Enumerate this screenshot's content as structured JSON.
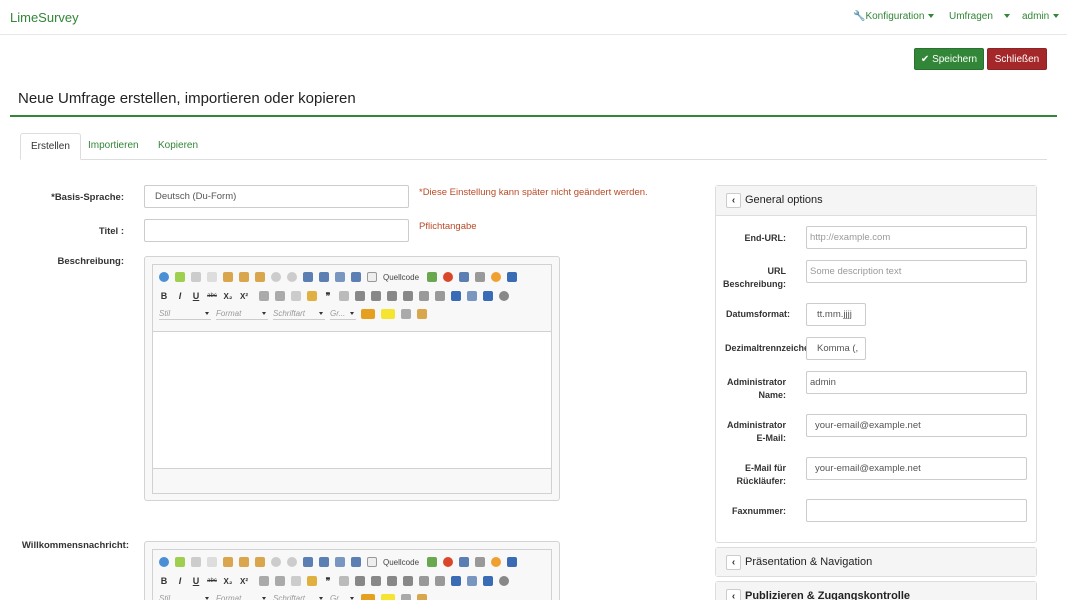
{
  "app": {
    "brand": "LimeSurvey"
  },
  "nav": {
    "config": "Konfiguration",
    "surveys": "Umfragen",
    "user": "admin"
  },
  "actions": {
    "save": "Speichern",
    "close": "Schließen"
  },
  "page": {
    "title": "Neue Umfrage erstellen, importieren oder kopieren"
  },
  "tabs": [
    "Erstellen",
    "Importieren",
    "Kopieren"
  ],
  "form": {
    "base_lang_label": "*Basis-Sprache:",
    "base_lang_value": "Deutsch (Du-Form)",
    "base_lang_hint": "*Diese Einstellung kann später nicht geändert werden.",
    "title_label": "Titel :",
    "title_hint": "Pflichtangabe",
    "desc_label": "Beschreibung:",
    "welcome_label": "Willkommensnachricht:"
  },
  "editor": {
    "source_label": "Quellcode",
    "style": "Stil",
    "format": "Format",
    "font": "Schriftart",
    "size": "Gr...",
    "bold": "B",
    "italic": "I",
    "underline": "U",
    "strike": "abc",
    "sub": "X₂",
    "sup": "X²",
    "quote": "❞"
  },
  "general": {
    "title": "General options",
    "end_url_label": "End-URL:",
    "end_url_ph": "http://example.com",
    "url_desc_label_1": "URL",
    "url_desc_label_2": "Beschreibung:",
    "url_desc_ph": "Some description text",
    "date_label": "Datumsformat:",
    "date_value": "tt.mm.jjjj",
    "decimal_label": "Dezimaltrennzeichen:",
    "decimal_value": "Komma (,",
    "admin_name_label_1": "Administrator",
    "admin_name_label_2": "Name:",
    "admin_name_value": "admin",
    "admin_email_label_1": "Administrator",
    "admin_email_label_2": "E-Mail:",
    "admin_email_value": "your-email@example.net",
    "bounce_label_1": "E-Mail für",
    "bounce_label_2": "Rückläufer:",
    "bounce_value": "your-email@example.net",
    "fax_label": "Faxnummer:"
  },
  "panels": {
    "presentation": "Präsentation & Navigation",
    "publish": "Publizieren & Zugangskontrolle"
  },
  "colors": {
    "brand": "#328637",
    "danger": "#a4282a",
    "hint": "#b84a26"
  }
}
